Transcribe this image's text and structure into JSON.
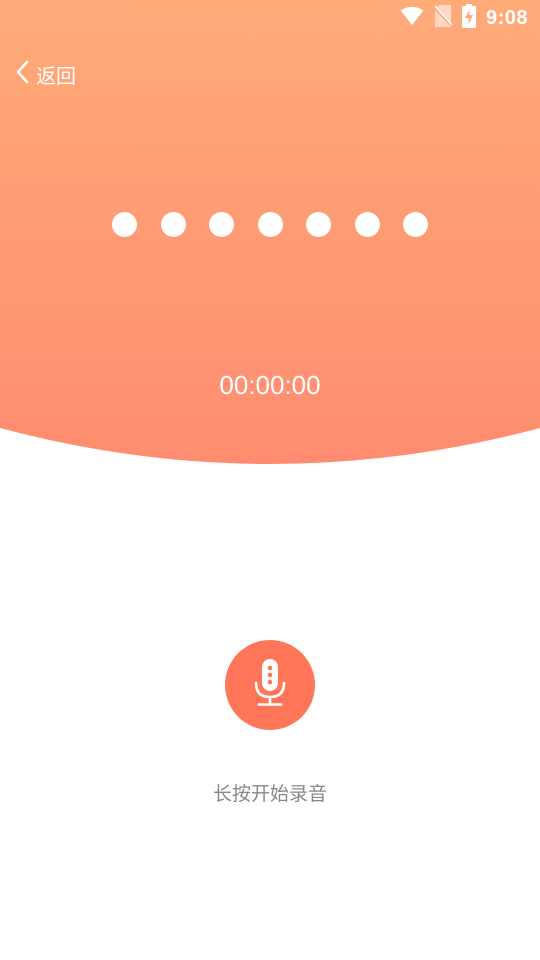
{
  "status_bar": {
    "time": "9:08",
    "icons": [
      "wifi-icon",
      "no-sim-icon",
      "battery-charging-icon"
    ]
  },
  "header": {
    "back_label": "返回",
    "back_icon": "chevron-left-icon"
  },
  "recorder": {
    "dot_count": 7,
    "timer": "00:00:00",
    "record_icon": "microphone-icon",
    "hint": "长按开始录音"
  },
  "colors": {
    "gradient_top": "#ffab78",
    "gradient_bottom": "#ff8c70",
    "accent": "#ff7758",
    "hint_text": "#888888"
  }
}
